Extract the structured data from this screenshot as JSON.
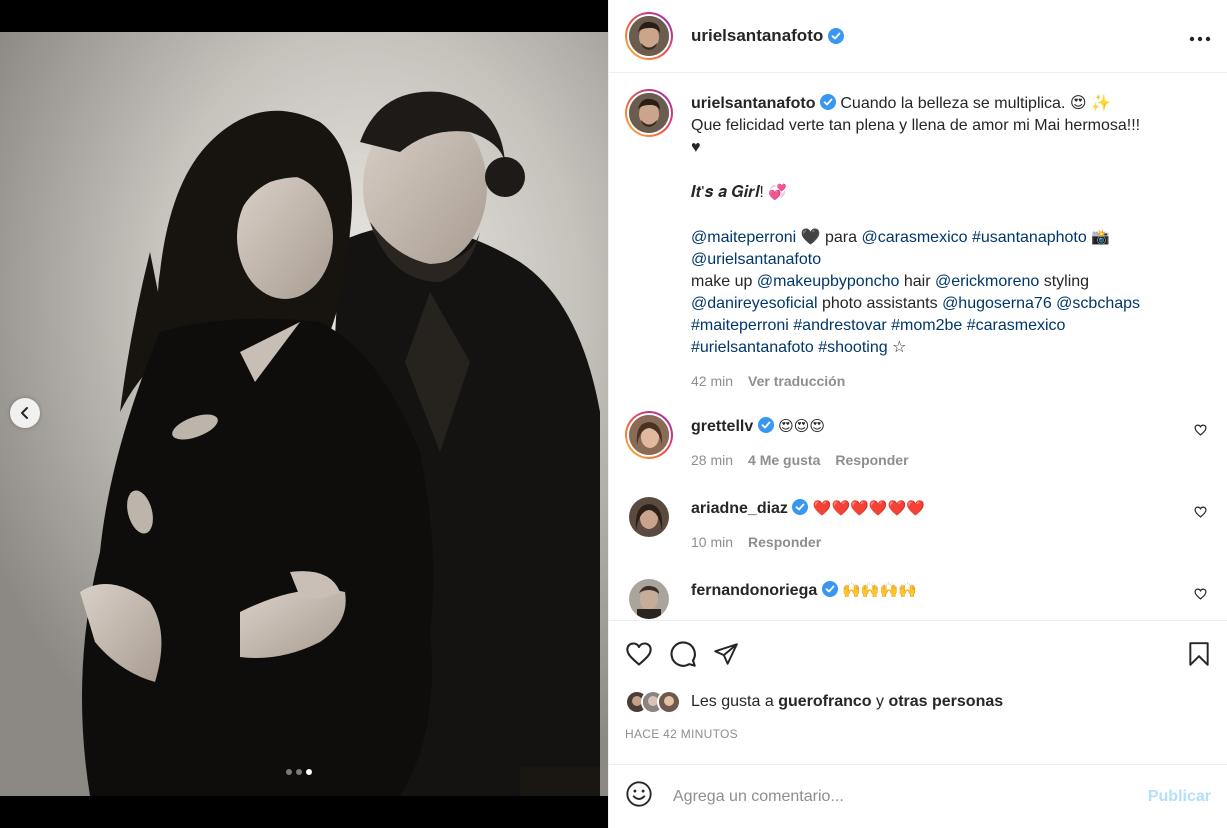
{
  "post": {
    "author": "urielsantanafoto",
    "verified": true,
    "carousel": {
      "total": 3,
      "active_index": 2
    }
  },
  "caption": {
    "username": "urielsantanafoto",
    "line1": "Cuando la belleza se multiplica. 😍 ✨",
    "line2": "Que felicidad verte tan plena y llena de amor mi Mai hermosa!!!",
    "line3": "♥",
    "its_a_girl": "𝑰𝒕'𝒔 𝒂 𝑮𝒊𝒓𝒍!",
    "its_a_girl_emoji": "💞",
    "mention1": "@maiteperroni",
    "heart": "🖤",
    "para": "para",
    "mention2": "@carasmexico",
    "tag_usantana": "#usantanaphoto",
    "camera": "📸",
    "mention3": "@urielsantanafoto",
    "makeup_label": "make up",
    "mention4": "@makeupbyponcho",
    "hair_label": "hair",
    "mention5": "@erickmoreno",
    "styling_label": "styling",
    "mention6": "@danireyesoficial",
    "assist_label": "photo assistants",
    "mention7": "@hugoserna76",
    "mention8": "@scbchaps",
    "tag1": "#maiteperroni",
    "tag2": "#andrestovar",
    "tag3": "#mom2be",
    "tag4": "#carasmexico",
    "tag5": "#urielsantanafoto",
    "tag6": "#shooting",
    "star": "☆",
    "time": "42 min",
    "translate": "Ver traducción"
  },
  "comments": [
    {
      "username": "grettellv",
      "verified": true,
      "text": "😍😍😍",
      "time": "28 min",
      "likes": "4 Me gusta",
      "reply": "Responder"
    },
    {
      "username": "ariadne_diaz",
      "verified": true,
      "text": "❤️❤️❤️❤️❤️❤️",
      "time": "10 min",
      "reply": "Responder"
    },
    {
      "username": "fernandonoriega",
      "verified": true,
      "text": "🙌🙌🙌🙌"
    }
  ],
  "likes": {
    "prefix": "Les gusta a",
    "user": "guerofranco",
    "connector": "y",
    "others": "otras personas"
  },
  "posted": "HACE 42 MINUTOS",
  "add_comment": {
    "placeholder": "Agrega un comentario...",
    "publish": "Publicar"
  },
  "colors": {
    "link": "#00376b",
    "verified": "#3897f0",
    "publish": "#b2dffc",
    "muted": "#8e8e8e"
  },
  "icons": [
    "chevron-left-icon",
    "more-icon",
    "verified-icon",
    "heart-icon",
    "comment-icon",
    "share-icon",
    "bookmark-icon",
    "smiley-icon"
  ]
}
